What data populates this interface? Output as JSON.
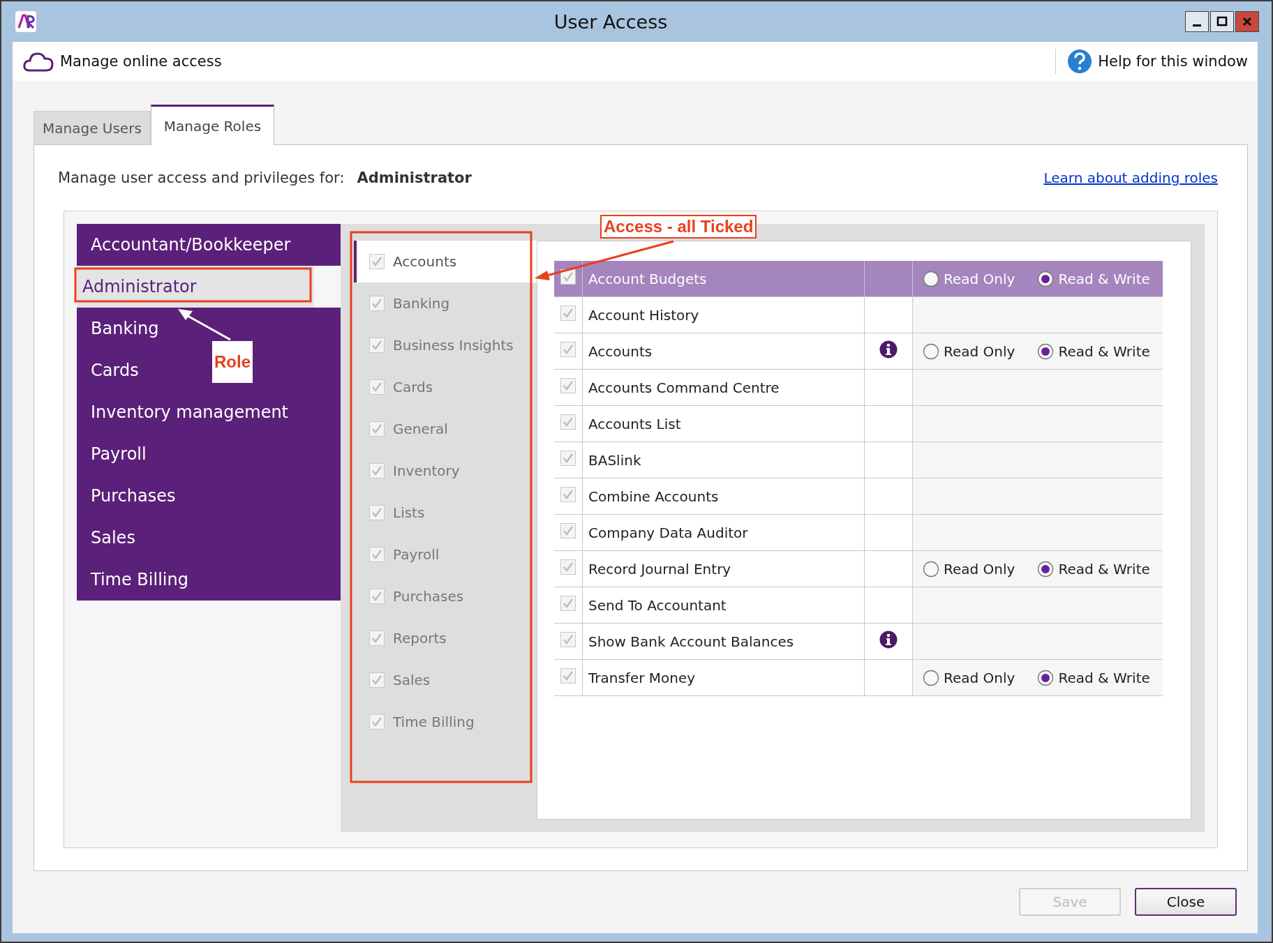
{
  "window": {
    "title": "User Access"
  },
  "toolbar": {
    "online_access": "Manage online access",
    "help": "Help for this window"
  },
  "tabs": [
    {
      "label": "Manage Users",
      "selected": false
    },
    {
      "label": "Manage Roles",
      "selected": true
    }
  ],
  "header": {
    "label": "Manage user access and privileges for:",
    "role": "Administrator",
    "link": "Learn about adding roles"
  },
  "roles": [
    {
      "label": "Accountant/Bookkeeper",
      "selected": false
    },
    {
      "label": "Administrator",
      "selected": true
    },
    {
      "label": "Banking",
      "selected": false
    },
    {
      "label": "Cards",
      "selected": false
    },
    {
      "label": "Inventory management",
      "selected": false
    },
    {
      "label": "Payroll",
      "selected": false
    },
    {
      "label": "Purchases",
      "selected": false
    },
    {
      "label": "Sales",
      "selected": false
    },
    {
      "label": "Time Billing",
      "selected": false
    }
  ],
  "categories": [
    {
      "label": "Accounts",
      "checked": true,
      "selected": true
    },
    {
      "label": "Banking",
      "checked": true,
      "selected": false
    },
    {
      "label": "Business Insights",
      "checked": true,
      "selected": false
    },
    {
      "label": "Cards",
      "checked": true,
      "selected": false
    },
    {
      "label": "General",
      "checked": true,
      "selected": false
    },
    {
      "label": "Inventory",
      "checked": true,
      "selected": false
    },
    {
      "label": "Lists",
      "checked": true,
      "selected": false
    },
    {
      "label": "Payroll",
      "checked": true,
      "selected": false
    },
    {
      "label": "Purchases",
      "checked": true,
      "selected": false
    },
    {
      "label": "Reports",
      "checked": true,
      "selected": false
    },
    {
      "label": "Sales",
      "checked": true,
      "selected": false
    },
    {
      "label": "Time Billing",
      "checked": true,
      "selected": false
    }
  ],
  "permissions": [
    {
      "name": "Account Budgets",
      "checked": true,
      "selected": true,
      "info": false,
      "access": [
        {
          "label": "Read Only",
          "selected": false
        },
        {
          "label": "Read & Write",
          "selected": true
        }
      ]
    },
    {
      "name": "Account History",
      "checked": true,
      "selected": false,
      "info": false
    },
    {
      "name": "Accounts",
      "checked": true,
      "selected": false,
      "info": true,
      "access": [
        {
          "label": "Read Only",
          "selected": false
        },
        {
          "label": "Read & Write",
          "selected": true
        }
      ]
    },
    {
      "name": "Accounts Command Centre",
      "checked": true,
      "selected": false,
      "info": false
    },
    {
      "name": "Accounts List",
      "checked": true,
      "selected": false,
      "info": false
    },
    {
      "name": "BASlink",
      "checked": true,
      "selected": false,
      "info": false
    },
    {
      "name": "Combine Accounts",
      "checked": true,
      "selected": false,
      "info": false
    },
    {
      "name": "Company Data Auditor",
      "checked": true,
      "selected": false,
      "info": false
    },
    {
      "name": "Record Journal Entry",
      "checked": true,
      "selected": false,
      "info": false,
      "access": [
        {
          "label": "Read Only",
          "selected": false
        },
        {
          "label": "Read & Write",
          "selected": true
        }
      ]
    },
    {
      "name": "Send To Accountant",
      "checked": true,
      "selected": false,
      "info": false
    },
    {
      "name": "Show Bank Account Balances",
      "checked": true,
      "selected": false,
      "info": true
    },
    {
      "name": "Transfer Money",
      "checked": true,
      "selected": false,
      "info": false,
      "access": [
        {
          "label": "Read Only",
          "selected": false
        },
        {
          "label": "Read & Write",
          "selected": true
        }
      ]
    }
  ],
  "annotations": [
    {
      "kind": "role",
      "label": "Role"
    },
    {
      "kind": "access",
      "label": "Access - all Ticked"
    }
  ],
  "buttons": [
    {
      "label": "Save",
      "disabled": true
    },
    {
      "label": "Close",
      "disabled": false
    }
  ]
}
